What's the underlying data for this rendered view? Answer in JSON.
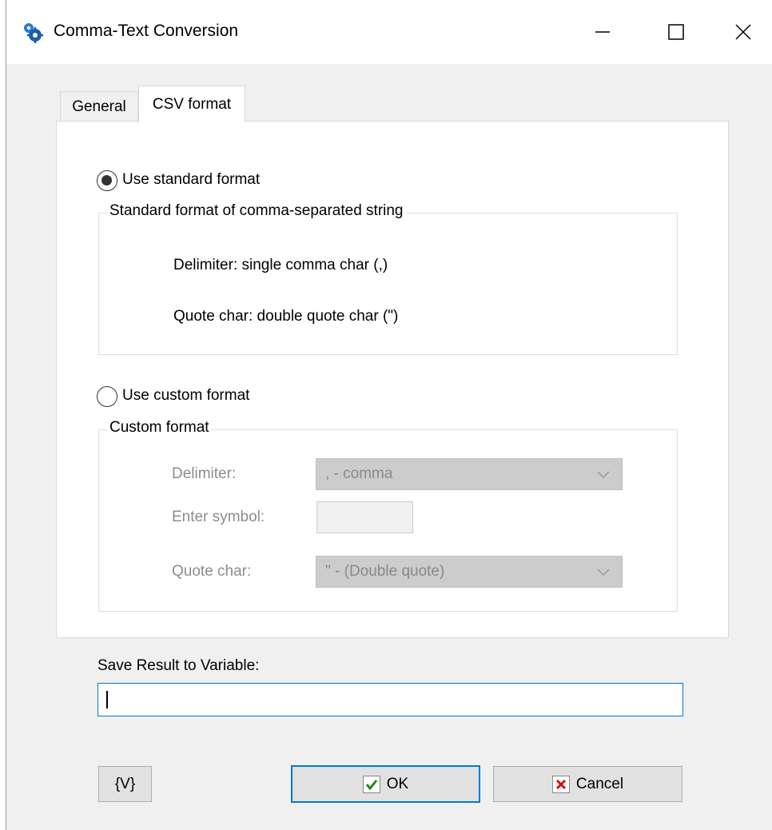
{
  "window": {
    "title": "Comma-Text Conversion",
    "controls": {
      "minimize": "minimize",
      "maximize": "maximize",
      "close": "close"
    }
  },
  "tabs": [
    {
      "label": "General",
      "active": false
    },
    {
      "label": "CSV format",
      "active": true
    }
  ],
  "standard": {
    "radio_label": "Use standard format",
    "selected": true,
    "group_title": "Standard format of comma-separated string",
    "delimiter_text": "Delimiter: single comma char (,)",
    "quote_text": "Quote char:  double quote char (\")"
  },
  "custom": {
    "radio_label": "Use custom format",
    "selected": false,
    "group_title": "Custom format",
    "delimiter_label": "Delimiter:",
    "delimiter_value": ", - comma",
    "symbol_label": "Enter symbol:",
    "symbol_value": "",
    "quote_label": "Quote char:",
    "quote_value": "\" - (Double quote)"
  },
  "result": {
    "label": "Save Result to Variable:",
    "value": ""
  },
  "buttons": {
    "variables": "{V}",
    "ok": "OK",
    "cancel": "Cancel"
  },
  "colors": {
    "accent": "#0078d7",
    "ok_check": "#1e8a1e",
    "cancel_x": "#d01010",
    "app_icon": "#2b7bd6"
  }
}
